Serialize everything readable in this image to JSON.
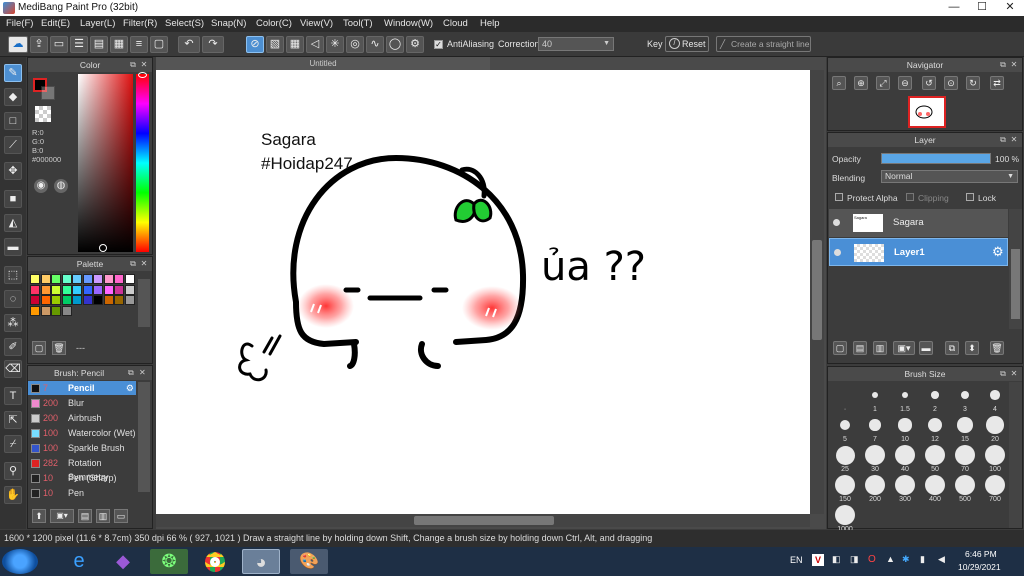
{
  "window": {
    "title": "MediBang Paint Pro (32bit)",
    "min": "—",
    "max": "☐",
    "close": "✕"
  },
  "menu": [
    "File(F)",
    "Edit(E)",
    "Layer(L)",
    "Filter(R)",
    "Select(S)",
    "Snap(N)",
    "Color(C)",
    "View(V)",
    "Tool(T)",
    "Window(W)",
    "Cloud",
    "Help"
  ],
  "toolbar": {
    "antialiasing_label": "AntiAliasing",
    "antialiasing_checked": true,
    "correction_label": "Correction",
    "correction_value": "40",
    "key_label": "Key",
    "reset_label": "Reset",
    "straight_line_label": "Create a straight line"
  },
  "document": {
    "tab_title": "Untitled"
  },
  "canvas_text": {
    "line1": "Sagara",
    "line2": "#Hoidap247",
    "scribble": "ủa ??"
  },
  "color_panel": {
    "title": "Color",
    "primary_color": "#000000",
    "r": "R:0",
    "g": "G:0",
    "b": "B:0",
    "hex": "#000000"
  },
  "palette_panel": {
    "title": "Palette",
    "swatches": [
      "#ffff66",
      "#ffcc66",
      "#66ff66",
      "#66ffcc",
      "#66ccff",
      "#6699ff",
      "#cc99ff",
      "#ff99cc",
      "#ff66cc",
      "#ffffff",
      "#ff3366",
      "#ff9933",
      "#ccff33",
      "#33ff99",
      "#33ccff",
      "#3366ff",
      "#9966ff",
      "#ff66ff",
      "#cc3399",
      "#cccccc",
      "#cc0033",
      "#ff6600",
      "#99cc00",
      "#00cc66",
      "#0099cc",
      "#3333cc",
      "#000000",
      "#cc6600",
      "#996600",
      "#999999",
      "#ff9900",
      "#cc9966",
      "#669900",
      "#888888"
    ],
    "dash": "---"
  },
  "brush_panel": {
    "title": "Brush: Pencil",
    "items": [
      {
        "size": "7",
        "name": "Pencil",
        "color": "#111111",
        "selected": true
      },
      {
        "size": "200",
        "name": "Blur",
        "color": "#ee88cc",
        "selected": false
      },
      {
        "size": "200",
        "name": "Airbrush",
        "color": "#cccccc",
        "selected": false
      },
      {
        "size": "100",
        "name": "Watercolor (Wet)",
        "color": "#77ddff",
        "selected": false
      },
      {
        "size": "100",
        "name": "Sparkle Brush",
        "color": "#3355cc",
        "selected": false
      },
      {
        "size": "282",
        "name": "Rotation Symmetry",
        "color": "#dd2222",
        "selected": false
      },
      {
        "size": "10",
        "name": "Pen (Sharp)",
        "color": "#222222",
        "selected": false
      },
      {
        "size": "10",
        "name": "Pen",
        "color": "#222222",
        "selected": false
      }
    ]
  },
  "navigator": {
    "title": "Navigator"
  },
  "layer_panel": {
    "title": "Layer",
    "opacity_label": "Opacity",
    "opacity_value": "100 %",
    "opacity_fraction": 1.0,
    "blending_label": "Blending",
    "blending_value": "Normal",
    "protect_alpha": "Protect Alpha",
    "clipping": "Clipping",
    "lock": "Lock",
    "layers": [
      {
        "name": "Sagara",
        "selected": false
      },
      {
        "name": "Layer1",
        "selected": true
      }
    ]
  },
  "brush_size_panel": {
    "title": "Brush Size",
    "sizes": [
      "·",
      "1",
      "1.5",
      "2",
      "3",
      "4",
      "5",
      "7",
      "10",
      "12",
      "15",
      "20",
      "25",
      "30",
      "40",
      "50",
      "70",
      "100",
      "150",
      "200",
      "300",
      "400",
      "500",
      "700",
      "1000"
    ]
  },
  "status": {
    "text": "1600 * 1200 pixel   (11.6 * 8.7cm)   350 dpi   66 %   ( 927, 1021 )   Draw a straight line by holding down Shift, Change a brush size by holding down Ctrl, Alt, and dragging"
  },
  "taskbar": {
    "lang": "EN",
    "time": "6:46 PM",
    "date": "10/29/2021"
  }
}
